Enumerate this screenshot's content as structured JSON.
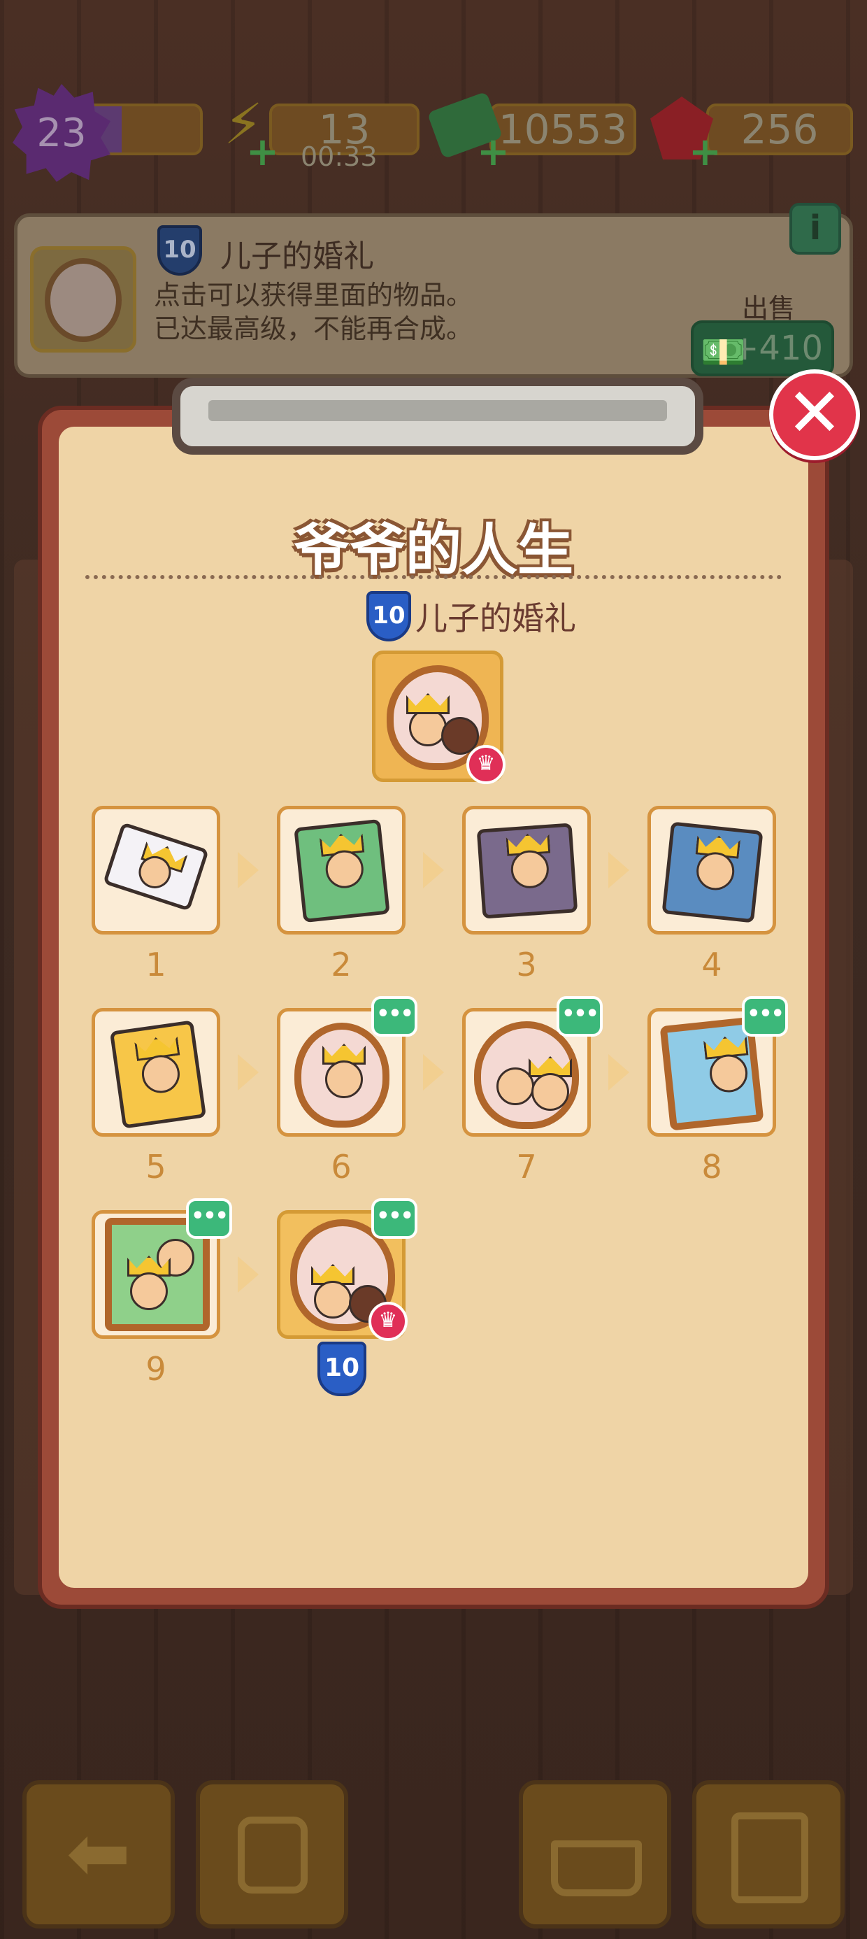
{
  "hud": {
    "level": "23",
    "energy": "13",
    "energy_timer": "00:33",
    "cash": "10553",
    "gems": "256"
  },
  "info_card": {
    "item_level": "10",
    "item_name": "儿子的婚礼",
    "description_line1": "点击可以获得里面的物品。",
    "description_line2": "已达最高级，不能再合成。",
    "info_icon": "i",
    "sell_label": "出售",
    "sell_price": "+410"
  },
  "modal": {
    "close_icon": "✕",
    "title": "爷爷的人生",
    "featured_level": "10",
    "featured_name": "儿子的婚礼",
    "chain": [
      {
        "label": "1",
        "has_badge": false
      },
      {
        "label": "2",
        "has_badge": false
      },
      {
        "label": "3",
        "has_badge": false
      },
      {
        "label": "4",
        "has_badge": false
      },
      {
        "label": "5",
        "has_badge": false
      },
      {
        "label": "6",
        "has_badge": true
      },
      {
        "label": "7",
        "has_badge": true
      },
      {
        "label": "8",
        "has_badge": true
      },
      {
        "label": "9",
        "has_badge": true
      },
      {
        "label": "10",
        "has_badge": true,
        "is_max": true
      }
    ],
    "badge_text": "•••",
    "crown_icon": "♛"
  },
  "toolbar": {
    "back_icon": "back-arrow-icon",
    "backpack_icon": "backpack-icon",
    "basket_icon": "basket-icon",
    "tasks_icon": "clipboard-star-icon"
  },
  "colors": {
    "modal_bg": "#efd4a6",
    "modal_border": "#9c4a38",
    "close_red": "#e1344a",
    "badge_green": "#3cb87a",
    "tile_number": "#c98a3a"
  }
}
